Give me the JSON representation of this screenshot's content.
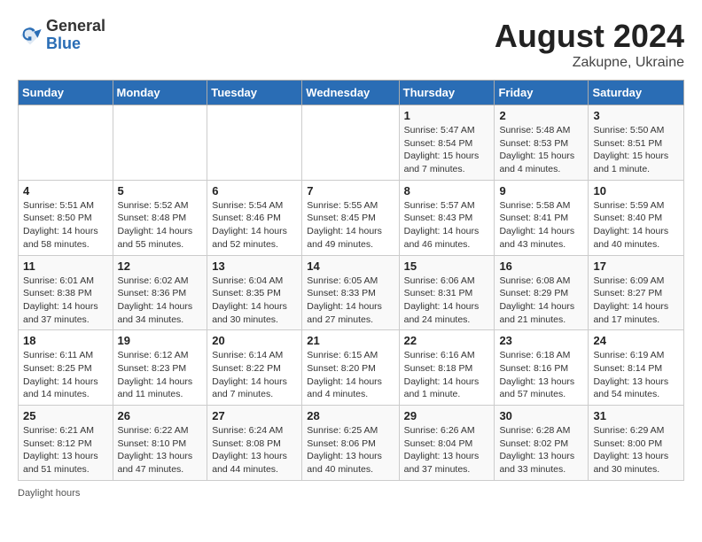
{
  "header": {
    "logo_general": "General",
    "logo_blue": "Blue",
    "month": "August 2024",
    "location": "Zakupne, Ukraine"
  },
  "weekdays": [
    "Sunday",
    "Monday",
    "Tuesday",
    "Wednesday",
    "Thursday",
    "Friday",
    "Saturday"
  ],
  "weeks": [
    [
      {
        "day": "",
        "info": ""
      },
      {
        "day": "",
        "info": ""
      },
      {
        "day": "",
        "info": ""
      },
      {
        "day": "",
        "info": ""
      },
      {
        "day": "1",
        "info": "Sunrise: 5:47 AM\nSunset: 8:54 PM\nDaylight: 15 hours and 7 minutes."
      },
      {
        "day": "2",
        "info": "Sunrise: 5:48 AM\nSunset: 8:53 PM\nDaylight: 15 hours and 4 minutes."
      },
      {
        "day": "3",
        "info": "Sunrise: 5:50 AM\nSunset: 8:51 PM\nDaylight: 15 hours and 1 minute."
      }
    ],
    [
      {
        "day": "4",
        "info": "Sunrise: 5:51 AM\nSunset: 8:50 PM\nDaylight: 14 hours and 58 minutes."
      },
      {
        "day": "5",
        "info": "Sunrise: 5:52 AM\nSunset: 8:48 PM\nDaylight: 14 hours and 55 minutes."
      },
      {
        "day": "6",
        "info": "Sunrise: 5:54 AM\nSunset: 8:46 PM\nDaylight: 14 hours and 52 minutes."
      },
      {
        "day": "7",
        "info": "Sunrise: 5:55 AM\nSunset: 8:45 PM\nDaylight: 14 hours and 49 minutes."
      },
      {
        "day": "8",
        "info": "Sunrise: 5:57 AM\nSunset: 8:43 PM\nDaylight: 14 hours and 46 minutes."
      },
      {
        "day": "9",
        "info": "Sunrise: 5:58 AM\nSunset: 8:41 PM\nDaylight: 14 hours and 43 minutes."
      },
      {
        "day": "10",
        "info": "Sunrise: 5:59 AM\nSunset: 8:40 PM\nDaylight: 14 hours and 40 minutes."
      }
    ],
    [
      {
        "day": "11",
        "info": "Sunrise: 6:01 AM\nSunset: 8:38 PM\nDaylight: 14 hours and 37 minutes."
      },
      {
        "day": "12",
        "info": "Sunrise: 6:02 AM\nSunset: 8:36 PM\nDaylight: 14 hours and 34 minutes."
      },
      {
        "day": "13",
        "info": "Sunrise: 6:04 AM\nSunset: 8:35 PM\nDaylight: 14 hours and 30 minutes."
      },
      {
        "day": "14",
        "info": "Sunrise: 6:05 AM\nSunset: 8:33 PM\nDaylight: 14 hours and 27 minutes."
      },
      {
        "day": "15",
        "info": "Sunrise: 6:06 AM\nSunset: 8:31 PM\nDaylight: 14 hours and 24 minutes."
      },
      {
        "day": "16",
        "info": "Sunrise: 6:08 AM\nSunset: 8:29 PM\nDaylight: 14 hours and 21 minutes."
      },
      {
        "day": "17",
        "info": "Sunrise: 6:09 AM\nSunset: 8:27 PM\nDaylight: 14 hours and 17 minutes."
      }
    ],
    [
      {
        "day": "18",
        "info": "Sunrise: 6:11 AM\nSunset: 8:25 PM\nDaylight: 14 hours and 14 minutes."
      },
      {
        "day": "19",
        "info": "Sunrise: 6:12 AM\nSunset: 8:23 PM\nDaylight: 14 hours and 11 minutes."
      },
      {
        "day": "20",
        "info": "Sunrise: 6:14 AM\nSunset: 8:22 PM\nDaylight: 14 hours and 7 minutes."
      },
      {
        "day": "21",
        "info": "Sunrise: 6:15 AM\nSunset: 8:20 PM\nDaylight: 14 hours and 4 minutes."
      },
      {
        "day": "22",
        "info": "Sunrise: 6:16 AM\nSunset: 8:18 PM\nDaylight: 14 hours and 1 minute."
      },
      {
        "day": "23",
        "info": "Sunrise: 6:18 AM\nSunset: 8:16 PM\nDaylight: 13 hours and 57 minutes."
      },
      {
        "day": "24",
        "info": "Sunrise: 6:19 AM\nSunset: 8:14 PM\nDaylight: 13 hours and 54 minutes."
      }
    ],
    [
      {
        "day": "25",
        "info": "Sunrise: 6:21 AM\nSunset: 8:12 PM\nDaylight: 13 hours and 51 minutes."
      },
      {
        "day": "26",
        "info": "Sunrise: 6:22 AM\nSunset: 8:10 PM\nDaylight: 13 hours and 47 minutes."
      },
      {
        "day": "27",
        "info": "Sunrise: 6:24 AM\nSunset: 8:08 PM\nDaylight: 13 hours and 44 minutes."
      },
      {
        "day": "28",
        "info": "Sunrise: 6:25 AM\nSunset: 8:06 PM\nDaylight: 13 hours and 40 minutes."
      },
      {
        "day": "29",
        "info": "Sunrise: 6:26 AM\nSunset: 8:04 PM\nDaylight: 13 hours and 37 minutes."
      },
      {
        "day": "30",
        "info": "Sunrise: 6:28 AM\nSunset: 8:02 PM\nDaylight: 13 hours and 33 minutes."
      },
      {
        "day": "31",
        "info": "Sunrise: 6:29 AM\nSunset: 8:00 PM\nDaylight: 13 hours and 30 minutes."
      }
    ]
  ],
  "footer": {
    "daylight_label": "Daylight hours"
  }
}
